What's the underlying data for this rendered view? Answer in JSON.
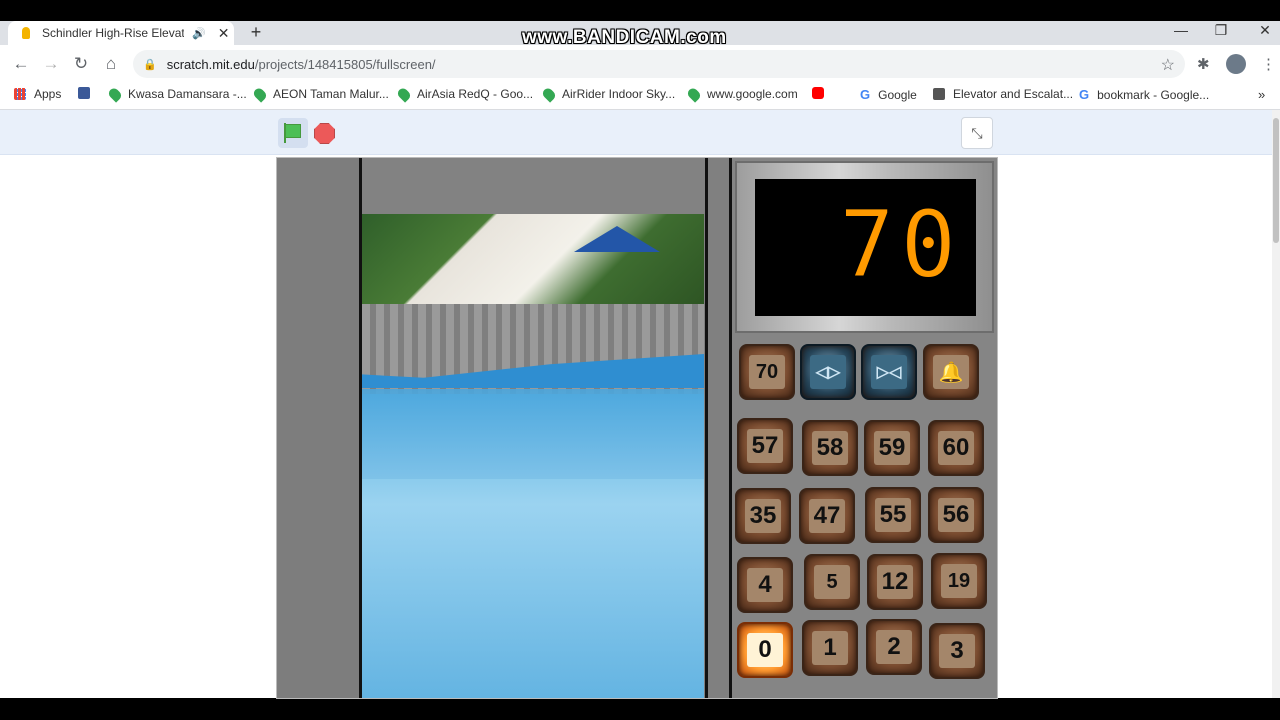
{
  "browser": {
    "tab_title": "Schindler High-Rise Elevator",
    "tab_audio_icon": "speaker-icon",
    "tab_close": "✕",
    "new_tab": "+",
    "watermark": "www.BANDICAM.com",
    "window_controls": [
      "—",
      "❐",
      "✕"
    ],
    "url_domain": "scratch.mit.edu",
    "url_path": "/projects/148415805/fullscreen/"
  },
  "bookmarks": [
    {
      "label": "Apps",
      "icon": "apps-grid-icon"
    },
    {
      "label": "",
      "icon": "facebook-icon"
    },
    {
      "label": "Kwasa Damansara -...",
      "icon": "maps-pin-icon"
    },
    {
      "label": "AEON Taman Malur...",
      "icon": "maps-pin-icon"
    },
    {
      "label": "AirAsia RedQ - Goo...",
      "icon": "maps-pin-icon"
    },
    {
      "label": "AirRider Indoor Sky...",
      "icon": "maps-pin-icon"
    },
    {
      "label": "www.google.com",
      "icon": "maps-pin-icon"
    },
    {
      "label": "",
      "icon": "youtube-icon"
    },
    {
      "label": "Google",
      "icon": "google-icon"
    },
    {
      "label": "Elevator and Escalat...",
      "icon": "page-icon"
    },
    {
      "label": "bookmark - Google...",
      "icon": "google-icon"
    }
  ],
  "elevator": {
    "display_floor": "70",
    "top_row": [
      {
        "label": "70",
        "kind": "floor"
      },
      {
        "label": "◁▷",
        "kind": "door-open"
      },
      {
        "label": "▷◁",
        "kind": "door-close"
      },
      {
        "label": "🔔",
        "kind": "alarm"
      }
    ],
    "floor_buttons": [
      [
        "57",
        "58",
        "59",
        "60"
      ],
      [
        "35",
        "47",
        "55",
        "56"
      ],
      [
        "4",
        "5",
        "12",
        "19"
      ],
      [
        "0",
        "1",
        "2",
        "3"
      ]
    ],
    "lit_button": "0"
  }
}
